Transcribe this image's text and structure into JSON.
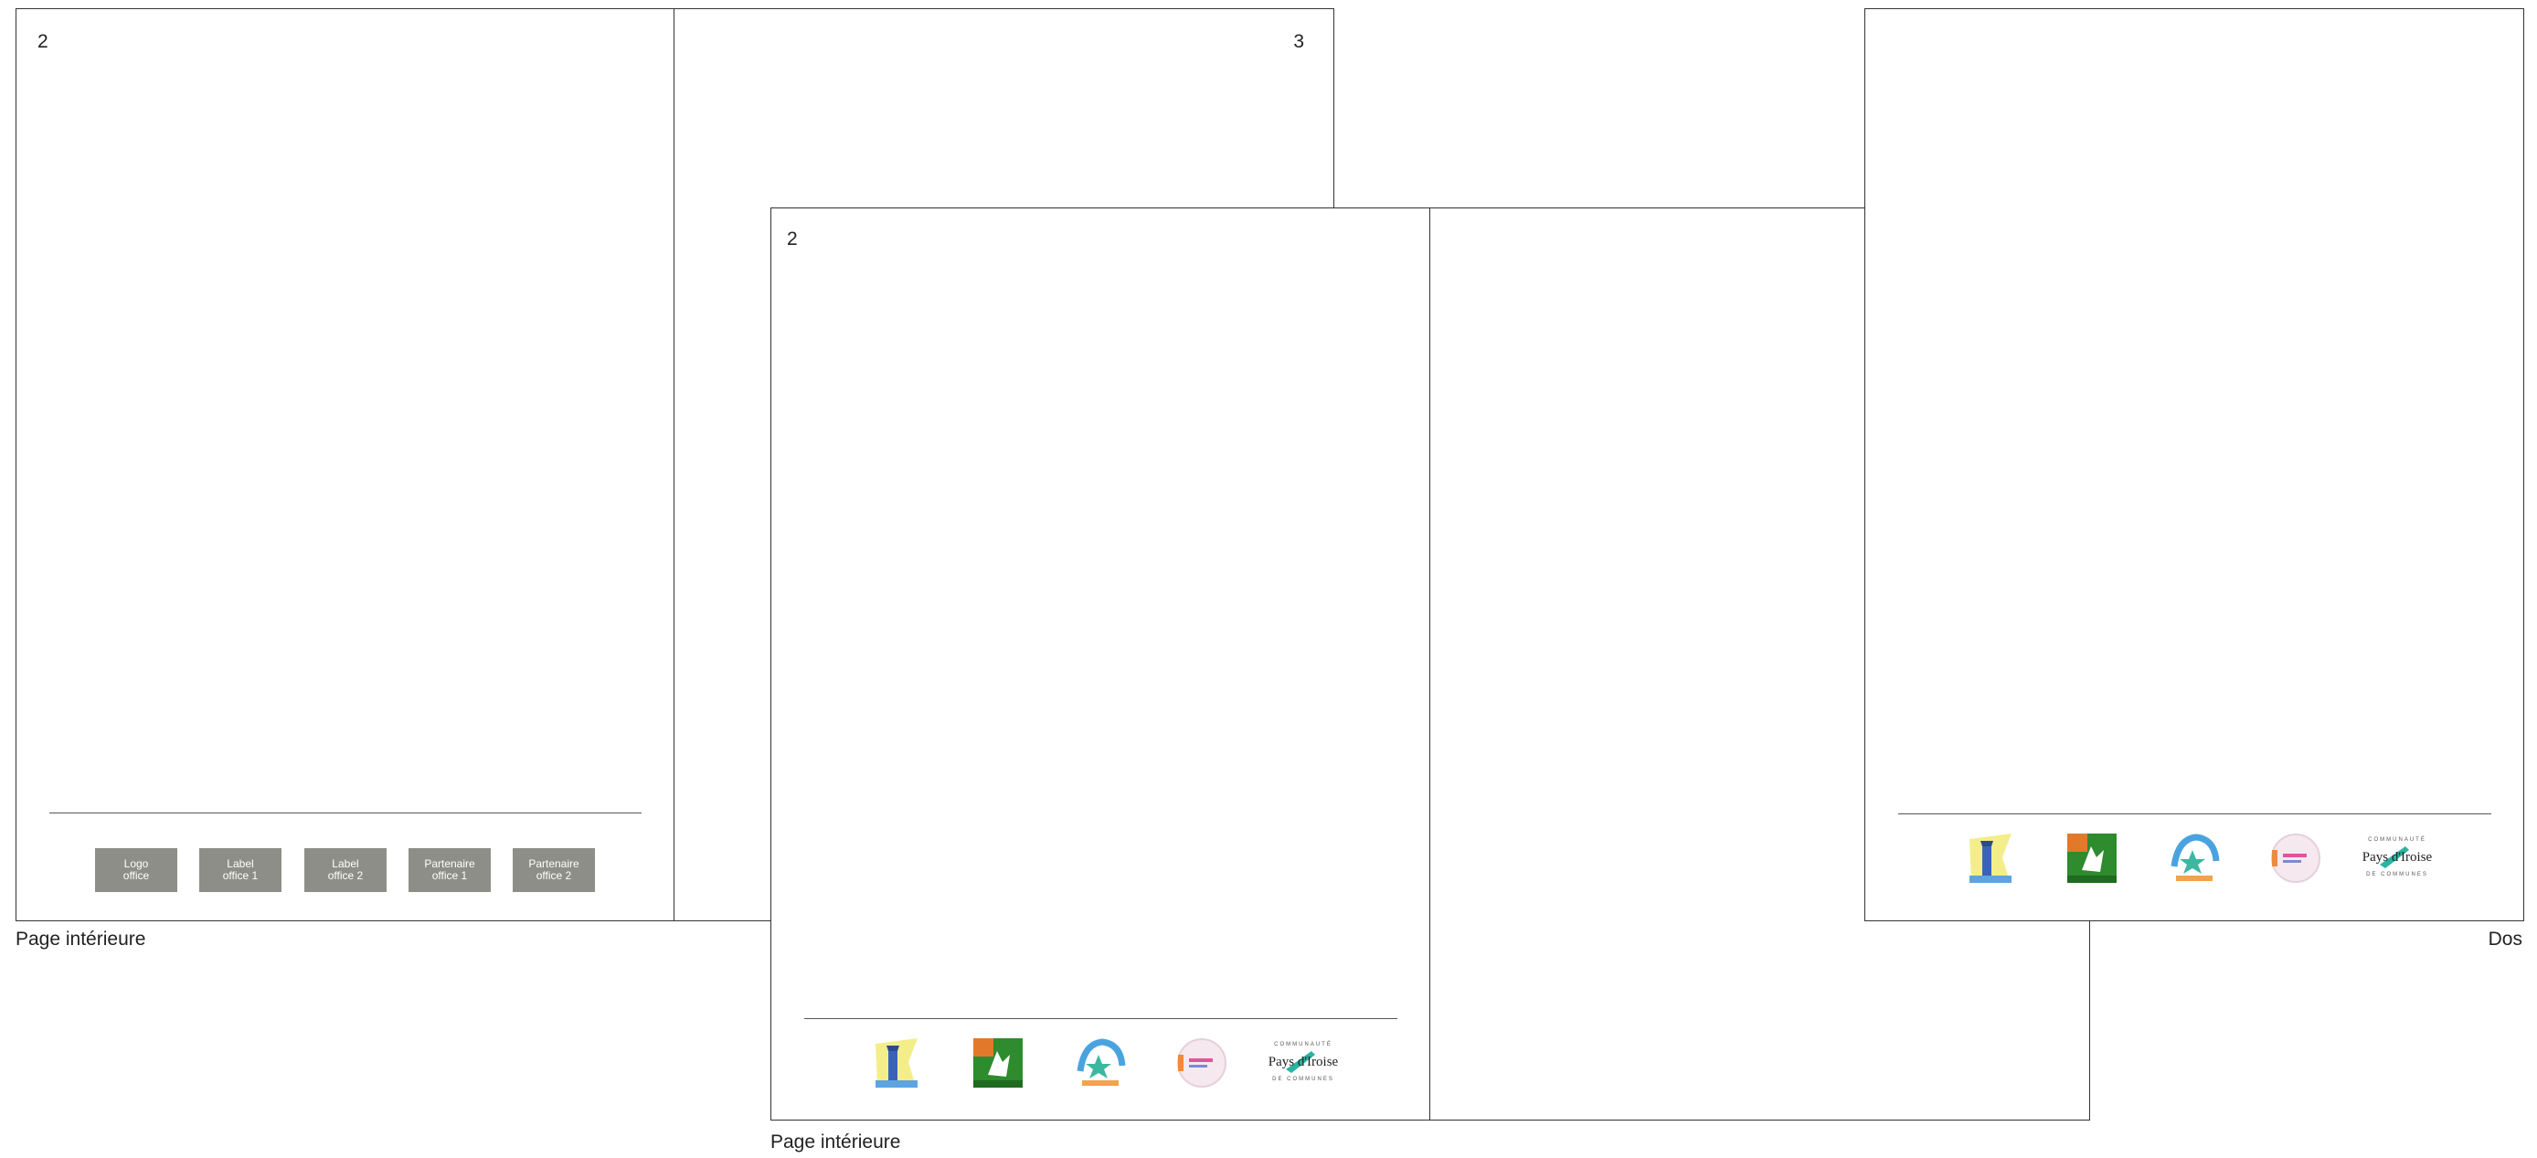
{
  "spread_top_left": {
    "left_page_number": "2",
    "right_page_number": "3",
    "caption": "Page intérieure",
    "placeholders": [
      {
        "label": "Logo\noffice"
      },
      {
        "label": "Label\noffice 1"
      },
      {
        "label": "Label\noffice 2"
      },
      {
        "label": "Partenaire\noffice 1"
      },
      {
        "label": "Partenaire\noffice 2"
      }
    ]
  },
  "spread_center": {
    "left_page_number": "2",
    "caption": "Page intérieure",
    "logos": [
      {
        "icon": "lighthouse-logo-icon"
      },
      {
        "icon": "green-square-logo-icon"
      },
      {
        "icon": "famille-plus-logo-icon"
      },
      {
        "icon": "pink-circle-logo-icon"
      },
      {
        "icon": "pays-iroise-logo-icon",
        "text_top": "COMMUNAUTÉ",
        "text_main": "Pays d'Iroise",
        "text_bottom": "DE COMMUNES"
      }
    ]
  },
  "back_page": {
    "caption": "Dos",
    "logos": [
      {
        "icon": "lighthouse-logo-icon"
      },
      {
        "icon": "green-square-logo-icon"
      },
      {
        "icon": "famille-plus-logo-icon"
      },
      {
        "icon": "pink-circle-logo-icon"
      },
      {
        "icon": "pays-iroise-logo-icon",
        "text_top": "COMMUNAUTÉ",
        "text_main": "Pays d'Iroise",
        "text_bottom": "DE COMMUNES"
      }
    ]
  },
  "colors": {
    "placeholder_box": "#8e8e88",
    "border": "#333333"
  }
}
